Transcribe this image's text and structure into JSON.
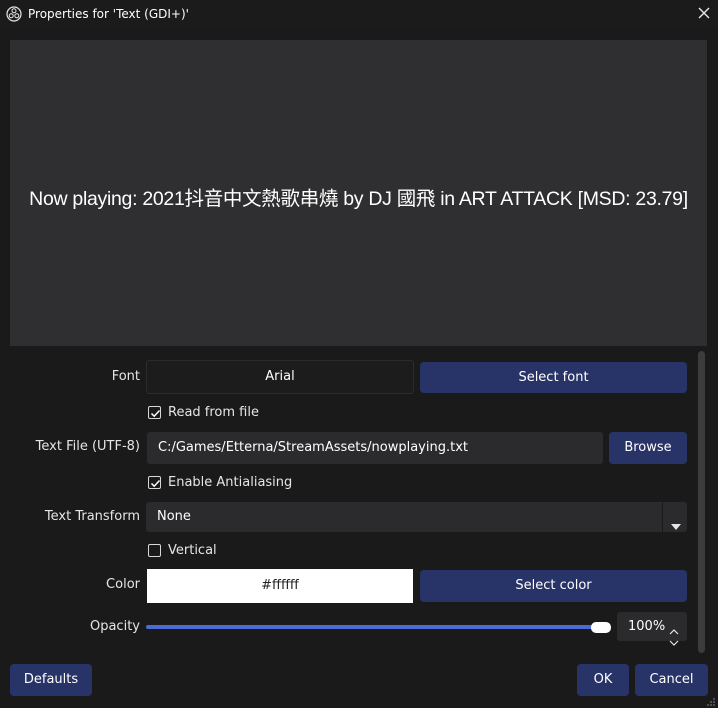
{
  "window": {
    "title": "Properties for 'Text (GDI+)'",
    "icons": {
      "app": "obs-logo-icon",
      "close": "close-icon"
    }
  },
  "preview": {
    "text": "Now playing: 2021抖音中文熱歌串燒 by DJ 國飛 in ART ATTACK [MSD: 23.79]"
  },
  "properties": {
    "font": {
      "label": "Font",
      "value": "Arial",
      "button": "Select font"
    },
    "read_from_file": {
      "label": "Read from file",
      "checked": true
    },
    "text_file": {
      "label": "Text File (UTF-8)",
      "value": "C:/Games/Etterna/StreamAssets/nowplaying.txt",
      "button": "Browse"
    },
    "antialiasing": {
      "label": "Enable Antialiasing",
      "checked": true
    },
    "text_transform": {
      "label": "Text Transform",
      "value": "None"
    },
    "vertical": {
      "label": "Vertical",
      "checked": false
    },
    "color": {
      "label": "Color",
      "value": "#ffffff",
      "button": "Select color",
      "swatch": "#ffffff"
    },
    "opacity": {
      "label": "Opacity",
      "value": "100%",
      "level": 1.0
    }
  },
  "footer": {
    "defaults": "Defaults",
    "ok": "OK",
    "cancel": "Cancel"
  },
  "colors": {
    "accent_button": "#283368",
    "slider": "#4a6bd6",
    "window_bg": "#1a1a1a",
    "preview_bg": "#2f2f31"
  }
}
